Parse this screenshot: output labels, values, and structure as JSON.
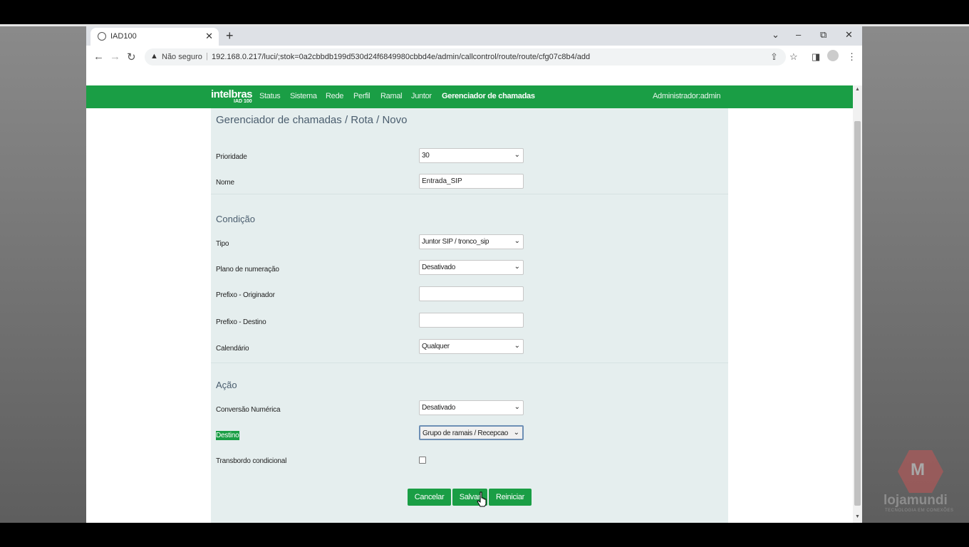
{
  "browser": {
    "tab_title": "IAD100",
    "tab_close": "✕",
    "new_tab": "+",
    "not_secure": "Não seguro",
    "url": "192.168.0.217/luci/;stok=0a2cbbdb199d530d24f6849980cbbd4e/admin/callcontrol/route/route/cfg07c8b4/add"
  },
  "header": {
    "brand": "intelbras",
    "brand_sub": "IAD 100",
    "menu": [
      "Status",
      "Sistema",
      "Rede",
      "Perfil",
      "Ramal",
      "Juntor",
      "Gerenciador de chamadas"
    ],
    "admin": "Administrador:admin"
  },
  "page": {
    "title": "Gerenciador de chamadas / Rota / Novo",
    "general": {
      "priority_label": "Prioridade",
      "priority_value": "30",
      "name_label": "Nome",
      "name_value": "Entrada_SIP"
    },
    "condition": {
      "heading": "Condição",
      "type_label": "Tipo",
      "type_value": "Juntor SIP / tronco_sip",
      "numbering_label": "Plano de numeração",
      "numbering_value": "Desativado",
      "prefix_origin_label": "Prefixo - Originador",
      "prefix_origin_value": "",
      "prefix_dest_label": "Prefixo - Destino",
      "prefix_dest_value": "",
      "calendar_label": "Calendário",
      "calendar_value": "Qualquer"
    },
    "action": {
      "heading": "Ação",
      "conversion_label": "Conversão Numérica",
      "conversion_value": "Desativado",
      "destination_label": "Destino",
      "destination_value": "Grupo de ramais / Recepcao",
      "overflow_label": "Transbordo condicional",
      "overflow_checked": false
    },
    "buttons": {
      "cancel": "Cancelar",
      "save": "Salvar",
      "reset": "Reiniciar"
    }
  },
  "watermark": {
    "logo_letter": "M",
    "name": "lojamundi",
    "tagline": "TECNOLOGIA EM CONEXÕES"
  },
  "colors": {
    "brand_green": "#1a9e45",
    "panel_bg": "#e5eeee",
    "heading_text": "#4a5d6e"
  }
}
